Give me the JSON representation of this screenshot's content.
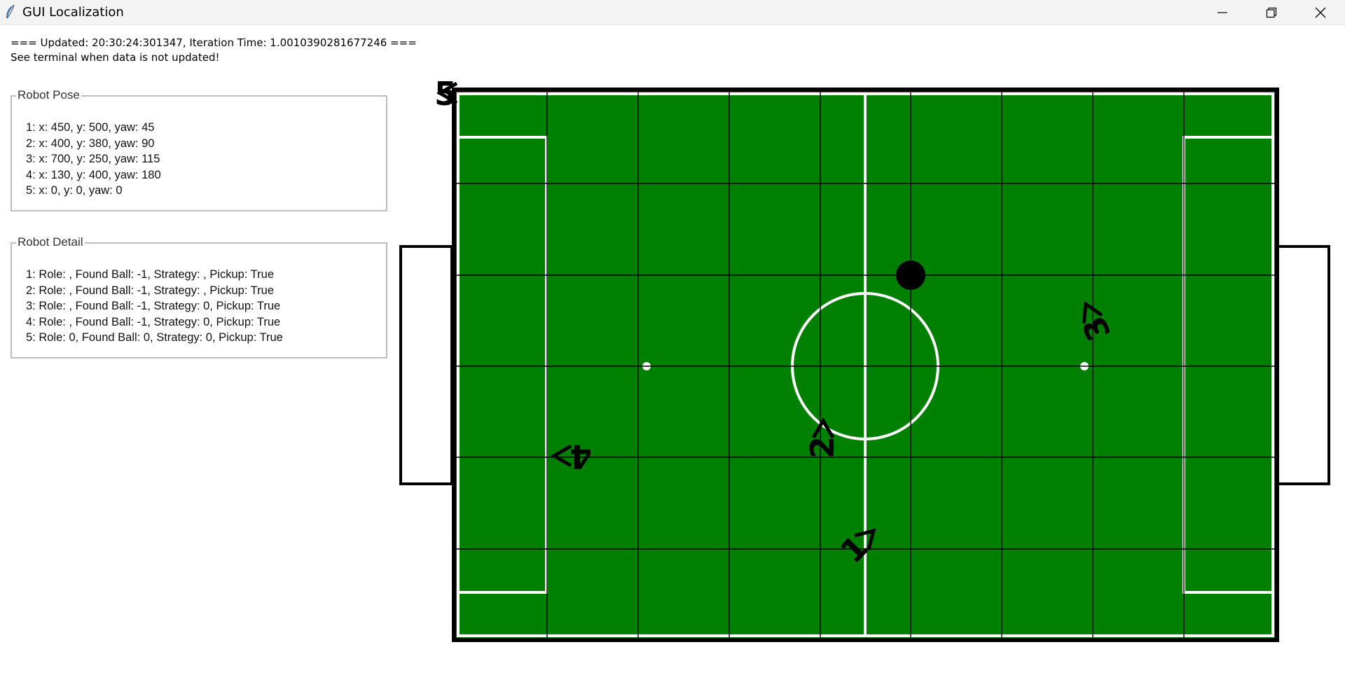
{
  "window": {
    "title": "GUI Localization",
    "controls": {
      "minimize": "minimize",
      "maximize": "maximize",
      "close": "close"
    }
  },
  "status": {
    "line1": "=== Updated: 20:30:24:301347, Iteration Time: 1.0010390281677246 ===",
    "line2": "See terminal when data is not updated!"
  },
  "robot_pose": {
    "title": "Robot Pose",
    "lines": [
      "1: x: 450, y: 500, yaw: 45",
      "2: x: 400, y: 380, yaw: 90",
      "3: x: 700, y: 250, yaw: 115",
      "4: x: 130, y: 400, yaw: 180",
      "5: x: 0, y: 0, yaw: 0"
    ]
  },
  "robot_detail": {
    "title": "Robot Detail",
    "lines": [
      "1: Role: , Found Ball: -1, Strategy: , Pickup: True",
      "2: Role: , Found Ball: -1, Strategy: , Pickup: True",
      "3: Role: , Found Ball: -1, Strategy: 0, Pickup: True",
      "4: Role: , Found Ball: -1, Strategy: 0, Pickup: True",
      "5: Role: 0, Found Ball: 0, Strategy: 0, Pickup: True"
    ]
  },
  "field": {
    "grass_color": "#008000",
    "line_color": "#ffffff",
    "grid_color": "#000000",
    "ball_color": "#000000",
    "robots": [
      {
        "label": "1"
      },
      {
        "label": "2"
      },
      {
        "label": "3"
      },
      {
        "label": "4"
      },
      {
        "label": "5"
      }
    ]
  }
}
